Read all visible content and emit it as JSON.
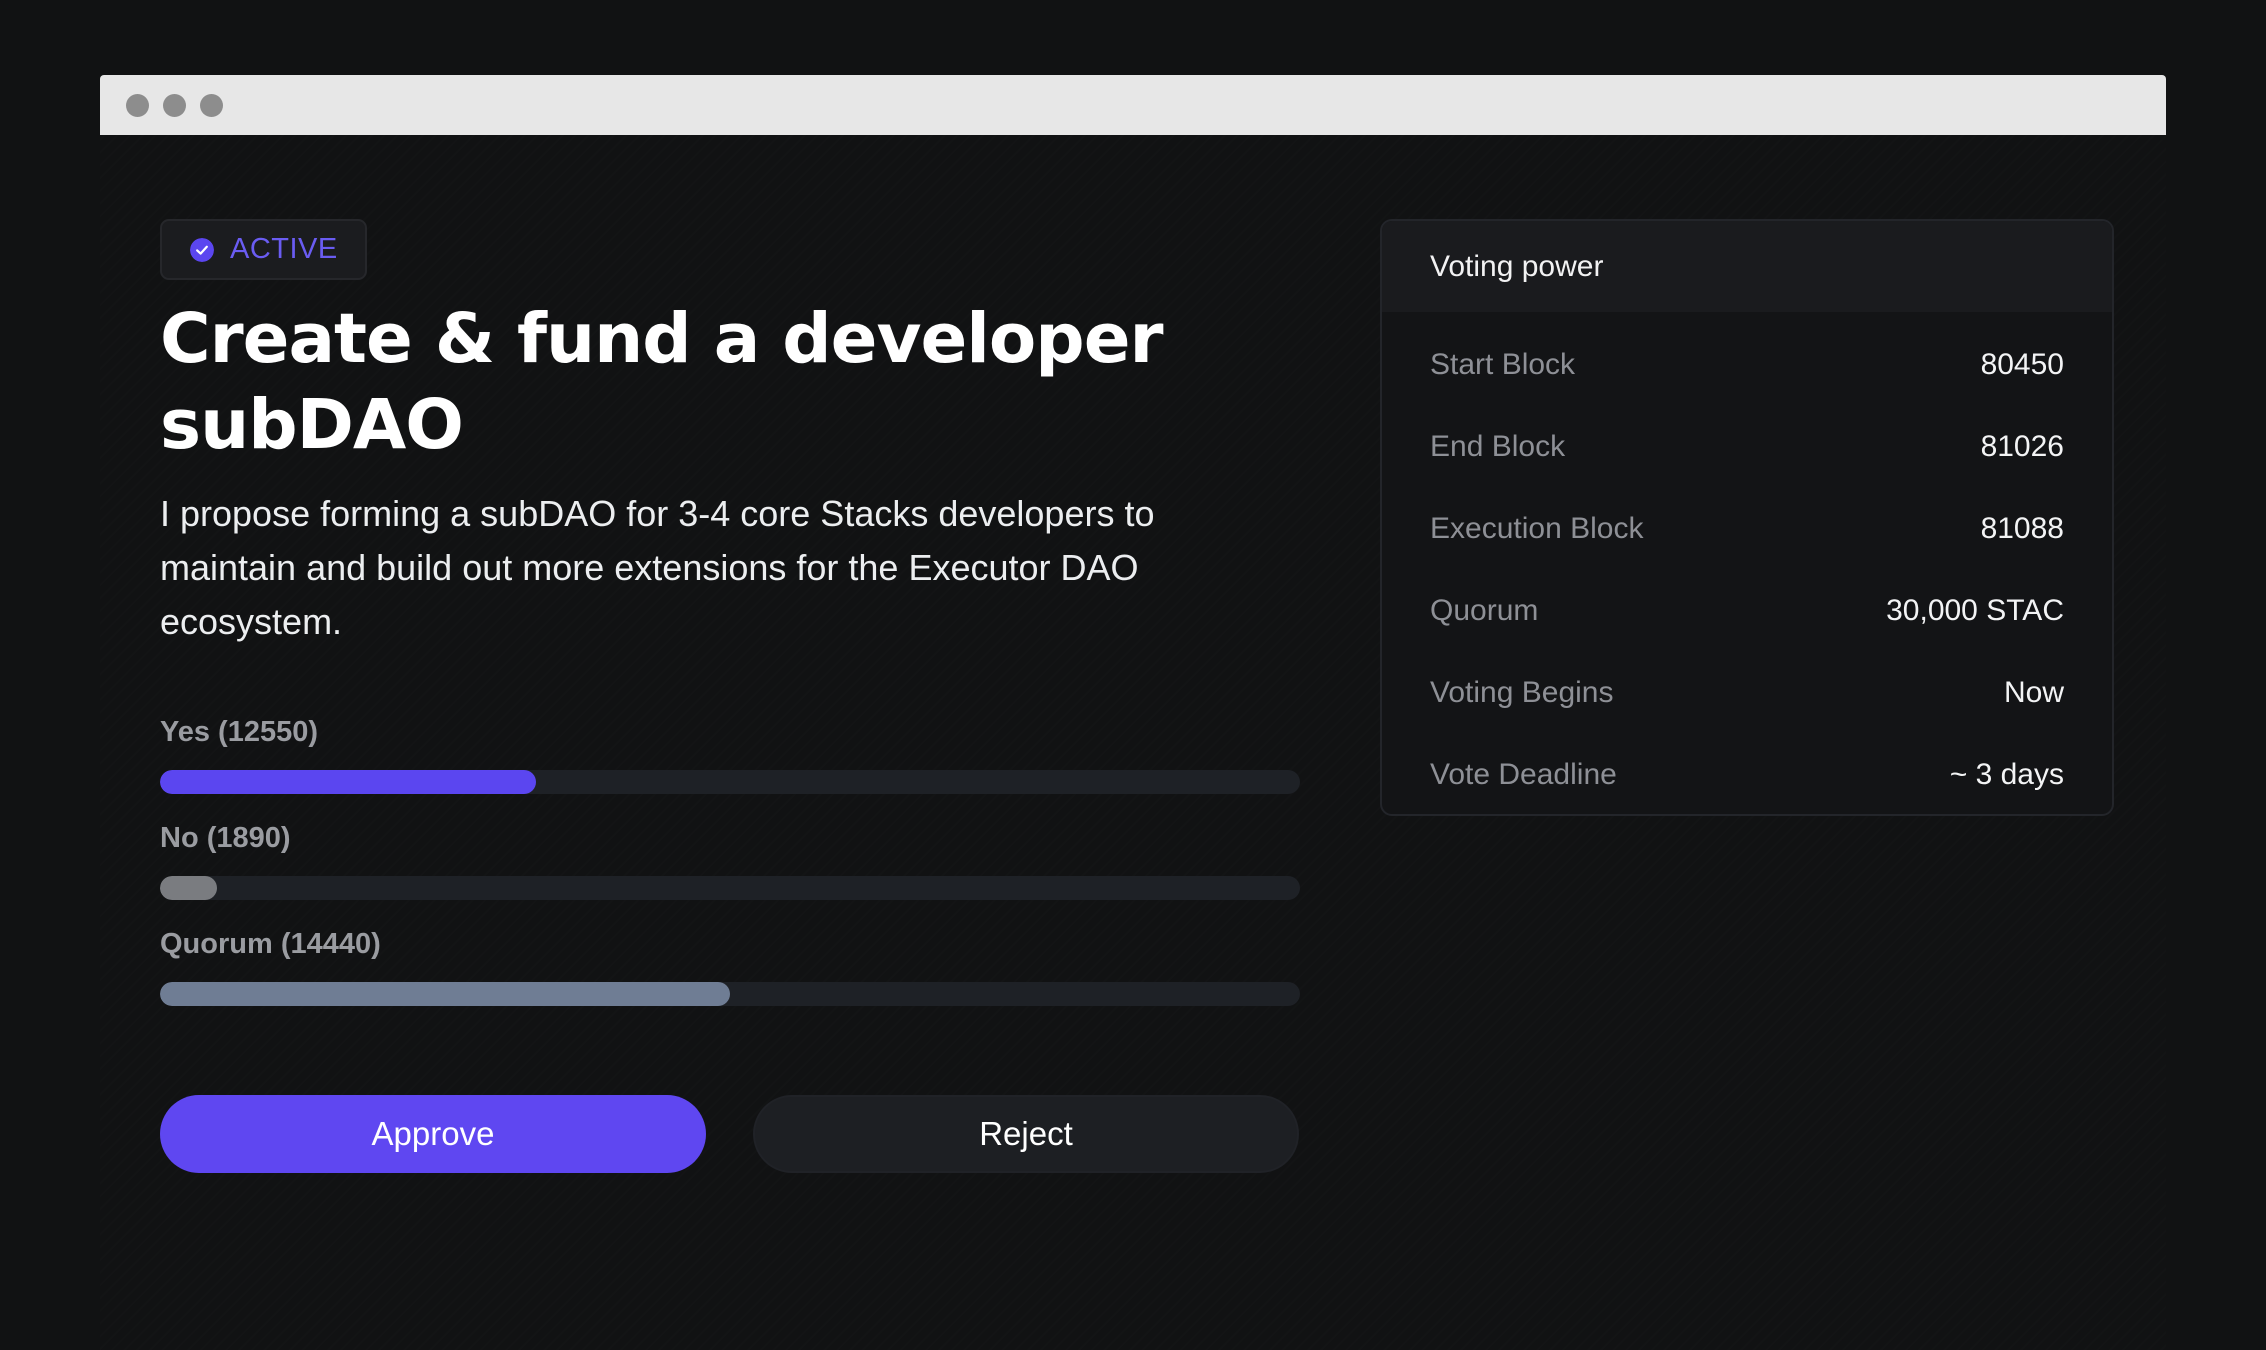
{
  "window": {
    "controls": [
      "close-dot",
      "minimize-dot",
      "maximize-dot"
    ]
  },
  "proposal": {
    "status": "ACTIVE",
    "status_color": "#5b46f0",
    "title": "Create & fund a developer subDAO",
    "description": "I propose forming a subDAO for 3-4 core Stacks developers to maintain and build out more extensions for the Executor DAO ecosystem."
  },
  "votes": [
    {
      "label": "Yes (12550)",
      "fraction": 0.33,
      "color": "#5b46f0"
    },
    {
      "label": "No (1890)",
      "fraction": 0.05,
      "color": "#7a7c80"
    },
    {
      "label": "Quorum (14440)",
      "fraction": 0.5,
      "color": "#6f7d94"
    }
  ],
  "actions": {
    "approve_label": "Approve",
    "reject_label": "Reject"
  },
  "voting_power": {
    "header": "Voting power",
    "rows": [
      {
        "label": "Start Block",
        "value": "80450"
      },
      {
        "label": "End Block",
        "value": "81026"
      },
      {
        "label": "Execution Block",
        "value": "81088"
      },
      {
        "label": "Quorum",
        "value": "30,000 STAC"
      },
      {
        "label": "Voting Begins",
        "value": "Now"
      },
      {
        "label": "Vote Deadline",
        "value": "~ 3 days"
      }
    ]
  },
  "icons": {
    "status": "check-circle-icon"
  }
}
